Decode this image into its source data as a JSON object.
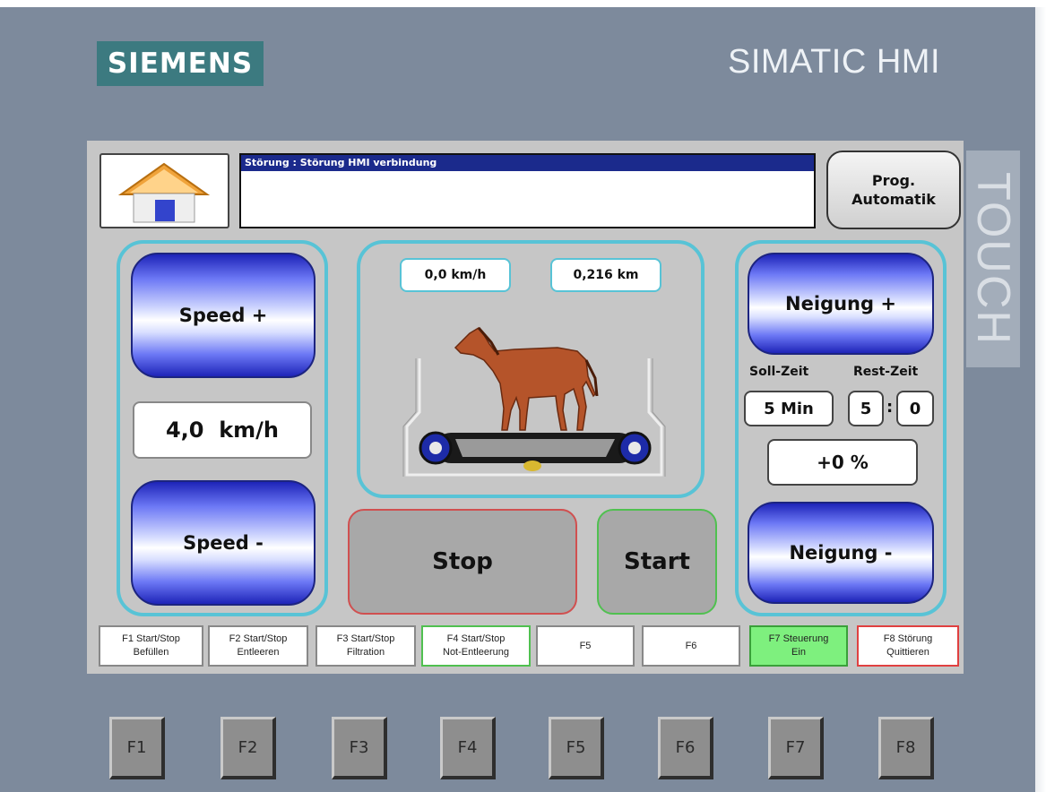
{
  "header": {
    "brand": "SIEMENS",
    "product": "SIMATIC HMI",
    "touch_label": "TOUCH"
  },
  "status": {
    "message": "Störung : Störung HMI verbindung"
  },
  "buttons": {
    "prog_line1": "Prog.",
    "prog_line2": "Automatik",
    "speed_plus": "Speed +",
    "speed_minus": "Speed -",
    "incline_plus": "Neigung +",
    "incline_minus": "Neigung -",
    "stop": "Stop",
    "start": "Start"
  },
  "speed": {
    "setpoint": "4,0  km/h"
  },
  "center": {
    "current_speed": "0,0 km/h",
    "distance": "0,216 km"
  },
  "time": {
    "soll_label": "Soll-Zeit",
    "rest_label": "Rest-Zeit",
    "soll_value": "5 Min",
    "rest_min": "5",
    "rest_sec": "0"
  },
  "incline": {
    "value": "+0 %"
  },
  "fkey_labels": [
    {
      "line1": "F1 Start/Stop",
      "line2": "Befüllen"
    },
    {
      "line1": "F2 Start/Stop",
      "line2": "Entleeren"
    },
    {
      "line1": "F3 Start/Stop",
      "line2": "Filtration"
    },
    {
      "line1": "F4 Start/Stop",
      "line2": "Not-Entleerung"
    },
    {
      "line1": "F5",
      "line2": ""
    },
    {
      "line1": "F6",
      "line2": ""
    },
    {
      "line1": "F7 Steuerung",
      "line2": "Ein"
    },
    {
      "line1": "F8 Störung",
      "line2": "Quittieren"
    }
  ],
  "fkeys": [
    "F1",
    "F2",
    "F3",
    "F4",
    "F5",
    "F6",
    "F7",
    "F8"
  ],
  "colors": {
    "panel_border": "#58c3d6",
    "message_bar": "#1b2a8c",
    "f7_active": "#7ef07e",
    "f8_alarm_border": "#e04040",
    "stop_border": "#d05050",
    "start_border": "#50c050"
  },
  "icons": {
    "home": "home-icon",
    "horse": "horse-icon",
    "treadmill": "treadmill-icon"
  }
}
